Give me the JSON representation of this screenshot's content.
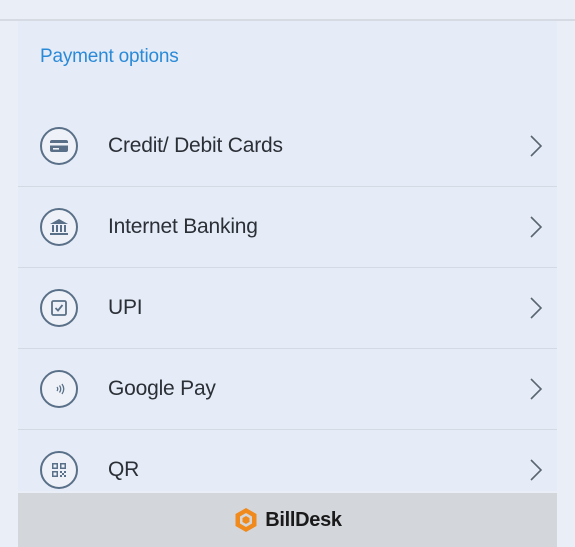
{
  "section_title": "Payment options",
  "options": [
    {
      "label": "Credit/ Debit Cards",
      "icon": "credit-card-icon"
    },
    {
      "label": "Internet Banking",
      "icon": "bank-icon"
    },
    {
      "label": "UPI",
      "icon": "upi-icon"
    },
    {
      "label": "Google Pay",
      "icon": "contactless-icon"
    },
    {
      "label": "QR",
      "icon": "qr-code-icon"
    }
  ],
  "footer": {
    "brand": "BillDesk",
    "brand_icon": "billdesk-logo-icon"
  },
  "colors": {
    "accent": "#2a8ad8",
    "background": "#e6ecf7",
    "text": "#2b2f36",
    "icon_stroke": "#5a7088",
    "brand_orange": "#f08a1c",
    "footer_bg": "#d3d7dc"
  }
}
